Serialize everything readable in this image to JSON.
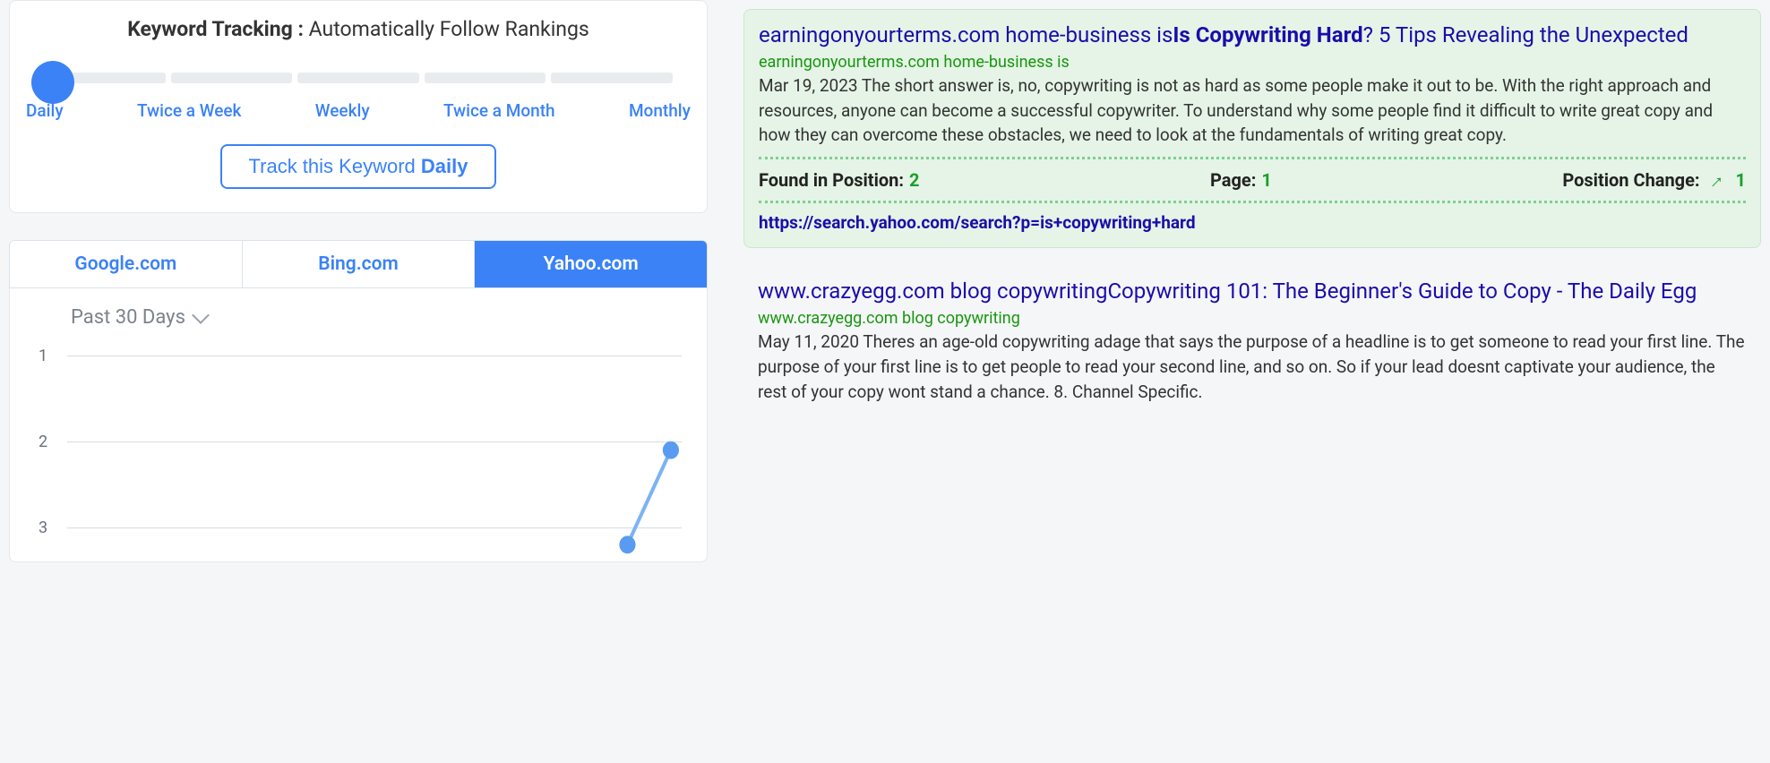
{
  "tracking": {
    "title_bold": "Keyword Tracking :",
    "title_rest": " Automatically Follow Rankings",
    "options": [
      "Daily",
      "Twice a Week",
      "Weekly",
      "Twice a Month",
      "Monthly"
    ],
    "selected_index": 0,
    "button_prefix": "Track this Keyword ",
    "button_freq": "Daily"
  },
  "tabs": {
    "items": [
      "Google.com",
      "Bing.com",
      "Yahoo.com"
    ],
    "active_index": 2
  },
  "chart": {
    "range_label": "Past 30 Days"
  },
  "chart_data": {
    "type": "line",
    "title": "",
    "xlabel": "",
    "ylabel": "",
    "y_ticks": [
      1,
      2,
      3
    ],
    "ylim": [
      3,
      1
    ],
    "x": [
      28,
      30
    ],
    "values": [
      3,
      2
    ],
    "x_range": [
      0,
      30
    ]
  },
  "results": [
    {
      "highlight": true,
      "title_pre": "earningonyourterms.com home-business is",
      "title_strong": "Is Copywriting Hard",
      "title_post": "? 5 Tips Revealing the Unexpected",
      "site": "earningonyourterms.com home-business is",
      "desc": "Mar 19, 2023 The short answer is, no, copywriting is not as hard as some people make it out to be. With the right approach and resources, anyone can become a successful copywriter. To understand why some people find it difficult to write great copy and how they can overcome these obstacles, we need to look at the fundamentals of writing great copy.",
      "meta": {
        "found_label": "Found in Position:",
        "found_value": "2",
        "page_label": "Page:",
        "page_value": "1",
        "change_label": "Position Change:",
        "change_value": "1",
        "change_dir": "up"
      },
      "url": "https://search.yahoo.com/search?p=is+copywriting+hard"
    },
    {
      "highlight": false,
      "title_pre": "www.crazyegg.com blog copywriting",
      "title_strong": "",
      "title_post": "Copywriting 101: The Beginner's Guide to Copy - The Daily Egg",
      "site": "www.crazyegg.com blog copywriting",
      "desc": "May 11, 2020 Theres an age-old copywriting adage that says the purpose of a headline is to get someone to read your first line. The purpose of your first line is to get people to read your second line, and so on. So if your lead doesnt captivate your audience, the rest of your copy wont stand a chance. 8. Channel Specific."
    }
  ]
}
